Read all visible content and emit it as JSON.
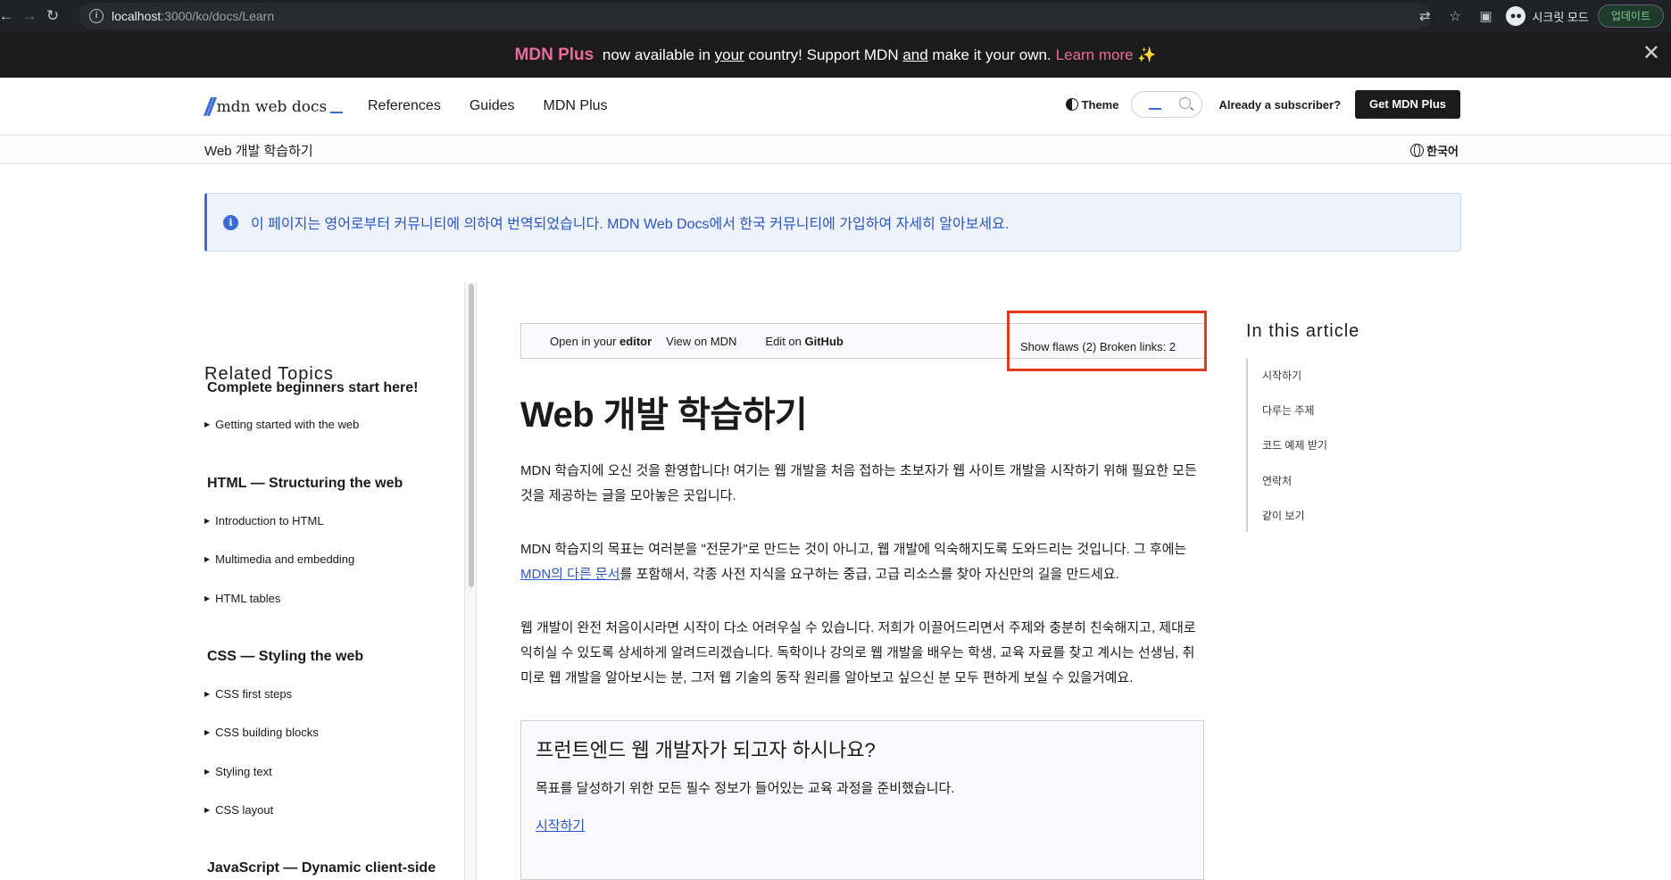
{
  "browser": {
    "url_host": "localhost",
    "url_rest": ":3000/ko/docs/Learn",
    "incognito_label": "시크릿 모드",
    "update_label": "업데이트"
  },
  "banner": {
    "brand": "MDN Plus",
    "text_1": " now available in ",
    "text_your": "your",
    "text_2": " country! Support MDN ",
    "text_and": "and",
    "text_3": " make it your own.",
    "learn_more": "Learn more ✨",
    "close": "✕"
  },
  "header": {
    "logo_text": "mdn web docs",
    "nav": [
      "References",
      "Guides",
      "MDN Plus"
    ],
    "theme": "Theme",
    "subscriber": "Already a subscriber?",
    "get_plus": "Get MDN Plus"
  },
  "breadcrumb": {
    "page": "Web 개발 학습하기",
    "language": "한국어"
  },
  "notice": {
    "text": "이 페이지는 영어로부터 커뮤니티에 의하여 번역되었습니다. MDN Web Docs에서 한국 커뮤니티에 가입하여 자세히 알아보세요."
  },
  "sidebar": {
    "title": "Related Topics",
    "sections": [
      {
        "title": "Complete beginners start here!",
        "items": [
          "Getting started with the web"
        ]
      },
      {
        "title": "HTML — Structuring the web",
        "items": [
          "Introduction to HTML",
          "Multimedia and embedding",
          "HTML tables"
        ]
      },
      {
        "title": "CSS — Styling the web",
        "items": [
          "CSS first steps",
          "CSS building blocks",
          "Styling text",
          "CSS layout"
        ]
      },
      {
        "title": "JavaScript — Dynamic client-side",
        "items": []
      }
    ]
  },
  "toolbar": {
    "open_prefix": "Open in your ",
    "open_bold": "editor",
    "view": "View on MDN",
    "edit_prefix": "Edit on ",
    "edit_bold": "GitHub",
    "flaws": "Show flaws (2) Broken links: 2"
  },
  "article": {
    "title": "Web 개발 학습하기",
    "p1": "MDN 학습지에 오신 것을 환영합니다! 여기는 웹 개발을 처음 접하는 초보자가 웹 사이트 개발을 시작하기 위해 필요한 모든 것을 제공하는 글을 모아놓은 곳입니다.",
    "p2_prefix": "MDN 학습지의 목표는 여러분을 \"전문가\"로 만드는 것이 아니고, 웹 개발에 익숙해지도록 도와드리는 것입니다. 그 후에는 ",
    "p2_link": "MDN의 다른 문서",
    "p2_suffix": "를 포함해서, 각종 사전 지식을 요구하는 중급, 고급 리소스를 찾아 자신만의 길을 만드세요.",
    "p3": "웹 개발이 완전 처음이시라면 시작이 다소 어려우실 수 있습니다. 저희가 이끌어드리면서 주제와 충분히 친숙해지고, 제대로 익히실 수 있도록 상세하게 알려드리겠습니다. 독학이나 강의로 웹 개발을 배우는 학생, 교육 자료를 찾고 계시는 선생님, 취미로 웹 개발을 알아보시는 분, 그저 웹 기술의 동작 원리를 알아보고 싶으신 분 모두 편하게 보실 수 있을거예요.",
    "card_title": "프런트엔드 웹 개발자가 되고자 하시나요?",
    "card_desc": "목표를 달성하기 위한 모든 필수 정보가 들어있는 교육 과정을 준비했습니다.",
    "card_link": "시작하기"
  },
  "toc": {
    "title": "In this article",
    "items": [
      "시작하기",
      "다루는 주제",
      "코드 예제 받기",
      "연락처",
      "같이 보기"
    ]
  },
  "colors": {
    "accent": "#3a6bd8",
    "plus_pink": "#e76d9b",
    "highlight_red": "#e13a1e"
  }
}
